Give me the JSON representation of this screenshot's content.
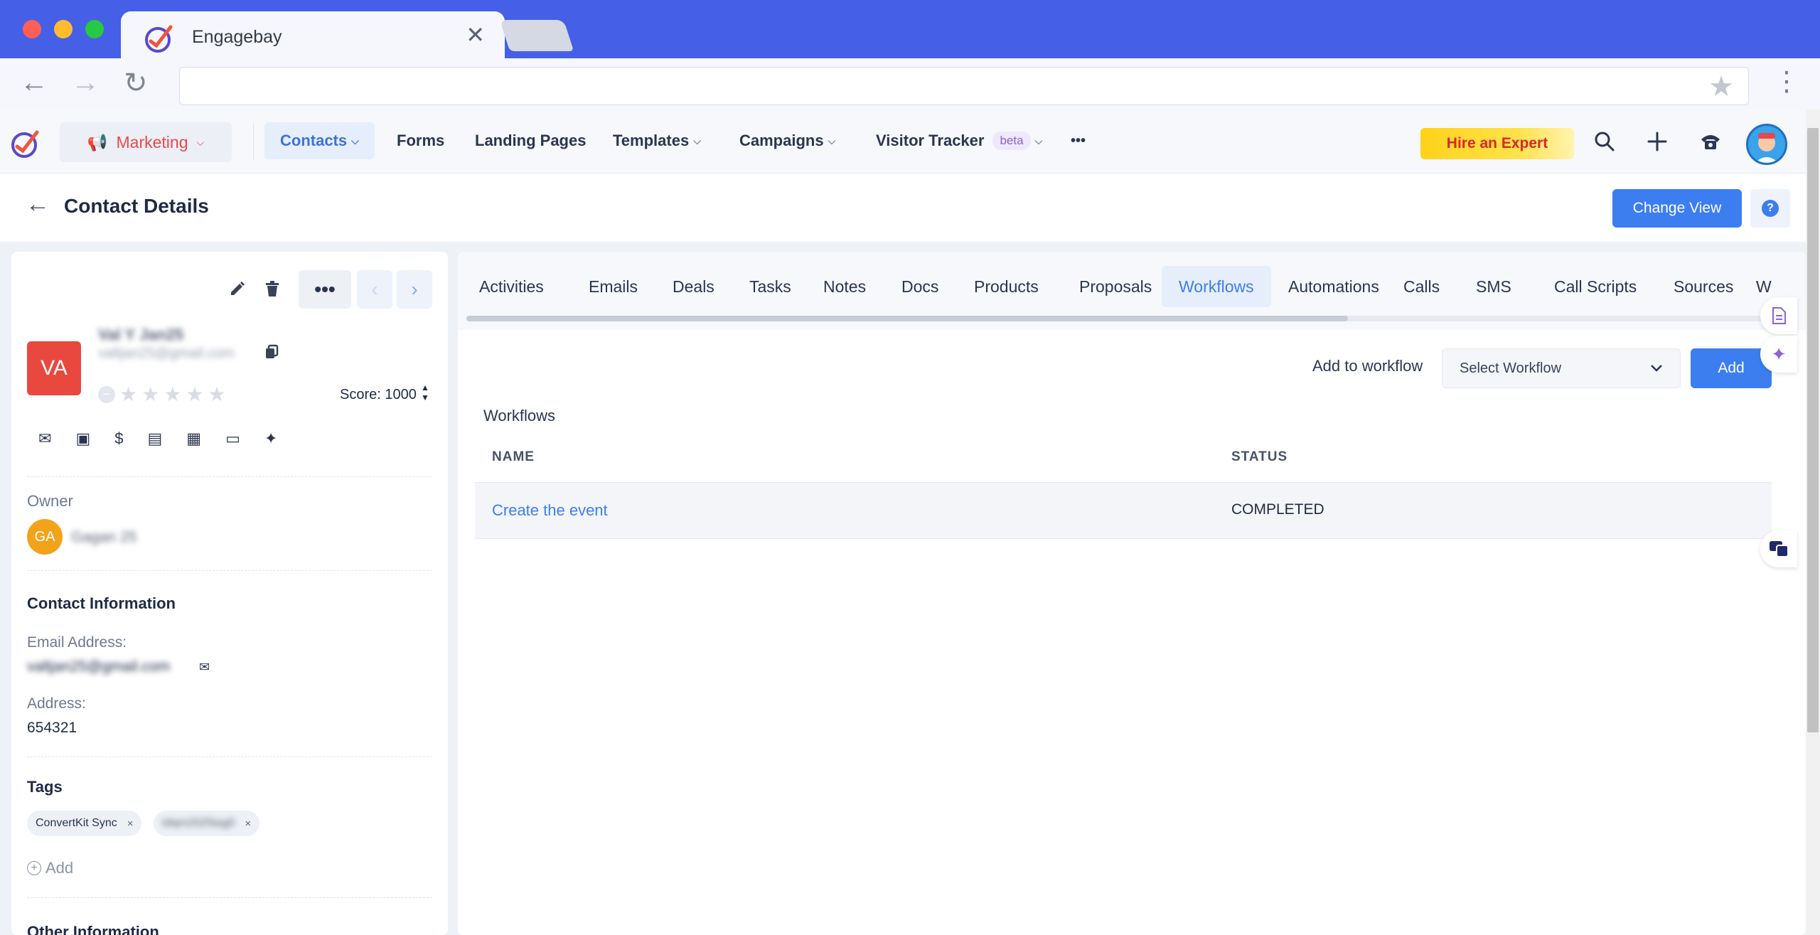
{
  "browser": {
    "tab_title": "Engagebay",
    "tab_close": "✕",
    "back": "←",
    "forward": "→",
    "reload": "↻",
    "bookmark": "★",
    "menu": "⋮"
  },
  "header": {
    "marketing_label": "Marketing",
    "nav": [
      {
        "label": "Contacts"
      },
      {
        "label": "Forms"
      },
      {
        "label": "Landing Pages"
      },
      {
        "label": "Templates"
      },
      {
        "label": "Campaigns"
      },
      {
        "label": "Visitor Tracker"
      }
    ],
    "beta_badge": "beta",
    "more": "•••",
    "hire_expert": "Hire an Expert"
  },
  "title_bar": {
    "title": "Contact Details",
    "change_view": "Change View",
    "help": "?"
  },
  "contact": {
    "initials": "VA",
    "name": "Val Y Jan25",
    "email_short": "valtjan25@gmail.com",
    "score_label": "Score: 1000",
    "owner_label": "Owner",
    "owner_initials": "GA",
    "owner_name": "Gagan 25",
    "contact_info_title": "Contact Information",
    "email_label": "Email Address:",
    "email_value": "valtjan25@gmail.com",
    "address_label": "Address:",
    "address_value": "654321",
    "tags_title": "Tags",
    "tags": [
      {
        "label": "ConvertKit Sync"
      },
      {
        "label": "tdqm2025tag0"
      }
    ],
    "add_tag": "Add",
    "other_info_title": "Other Information"
  },
  "tabs": [
    {
      "label": "Activities"
    },
    {
      "label": "Emails"
    },
    {
      "label": "Deals"
    },
    {
      "label": "Tasks"
    },
    {
      "label": "Notes"
    },
    {
      "label": "Docs"
    },
    {
      "label": "Products"
    },
    {
      "label": "Proposals"
    },
    {
      "label": "Workflows"
    },
    {
      "label": "Automations"
    },
    {
      "label": "Calls"
    },
    {
      "label": "SMS"
    },
    {
      "label": "Call Scripts"
    },
    {
      "label": "Sources"
    },
    {
      "label": "W"
    }
  ],
  "workflows": {
    "add_to_label": "Add to workflow",
    "select_placeholder": "Select Workflow",
    "add_button": "Add",
    "heading": "Workflows",
    "columns": {
      "name": "NAME",
      "status": "STATUS"
    },
    "rows": [
      {
        "name": "Create the event",
        "status": "COMPLETED"
      }
    ]
  },
  "colors": {
    "chrome": "#4560e6",
    "primary": "#3c7ef0",
    "marketing": "#e5484d",
    "avatar": "#e9483e",
    "owner_avatar": "#f2a31a"
  }
}
